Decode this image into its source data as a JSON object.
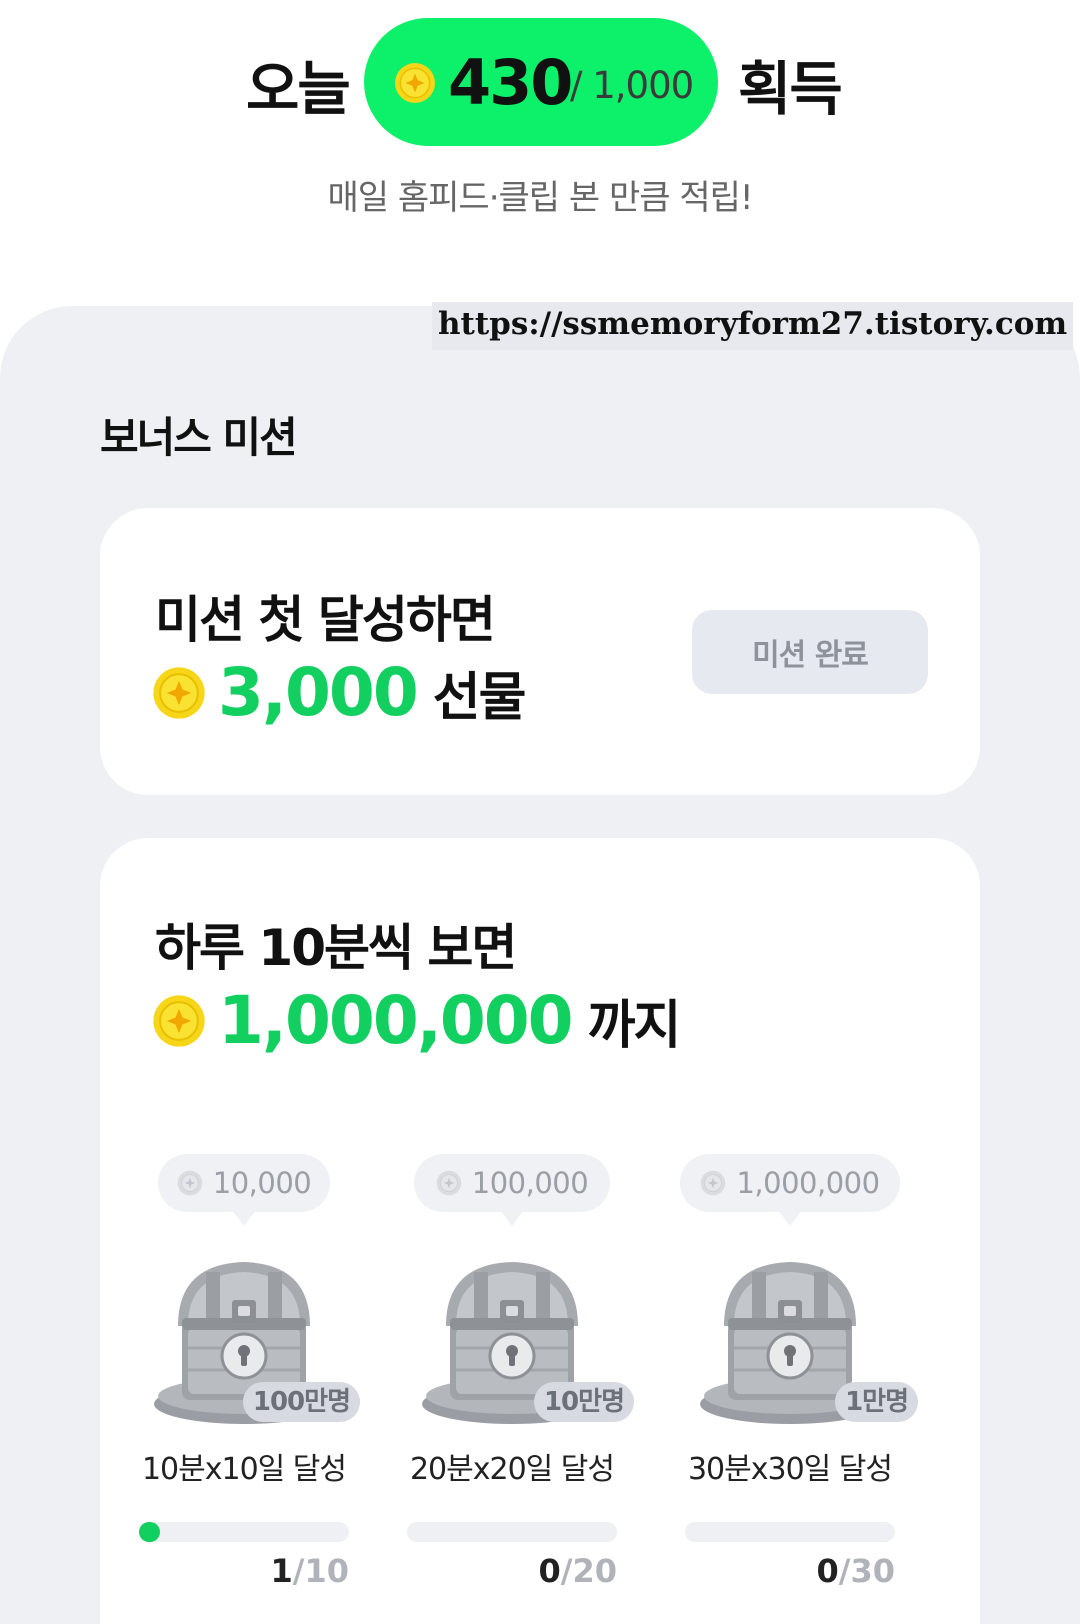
{
  "header": {
    "today_label": "오늘",
    "today_value": "430",
    "today_limit": "/ 1,000",
    "earn_label": "획득",
    "subtitle": "매일 홈피드·클립 본 만큼 적립!"
  },
  "watermark": "https://ssmemoryform27.tistory.com",
  "bonus": {
    "section_title": "보너스 미션",
    "first_mission": {
      "title": "미션 첫 달성하면",
      "amount": "3,000",
      "suffix": "선물",
      "button_label": "미션 완료"
    },
    "daily_mission": {
      "title": "하루 10분씩 보면",
      "amount": "1,000,000",
      "suffix": "까지",
      "tiers": [
        {
          "reward": "10,000",
          "badge": "100만명",
          "goal": "10분x10일 달성",
          "done": "1",
          "total": "/10",
          "progress": 0.1
        },
        {
          "reward": "100,000",
          "badge": "10만명",
          "goal": "20분x20일 달성",
          "done": "0",
          "total": "/20",
          "progress": 0
        },
        {
          "reward": "1,000,000",
          "badge": "1만명",
          "goal": "30분x30일 달성",
          "done": "0",
          "total": "/30",
          "progress": 0
        }
      ]
    }
  },
  "colors": {
    "accent_green": "#0df06a",
    "amount_green": "#12d05f",
    "panel_bg": "#eef0f4",
    "coin_gold": "#f5d20a"
  }
}
